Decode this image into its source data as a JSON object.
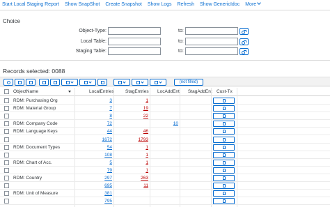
{
  "menu": {
    "items": [
      "Start Local Staging Report",
      "Show SnapShot",
      "Create Snapshot",
      "Show Logs",
      "Refresh",
      "Show GenericIdoc"
    ],
    "more_label": "More"
  },
  "choice": {
    "title": "Choice",
    "fields": [
      {
        "label": "Object-Type:",
        "value": "",
        "to_label": "to:",
        "to_value": ""
      },
      {
        "label": "Local Table:",
        "value": "",
        "to_label": "to:",
        "to_value": ""
      },
      {
        "label": "Staging Table:",
        "value": "",
        "to_label": "to:",
        "to_value": ""
      }
    ]
  },
  "records": {
    "label": "Records selected: 0088"
  },
  "toolbar": {
    "filter_badge": "(not filled)"
  },
  "grid": {
    "headers": {
      "object_name": "ObjectName",
      "local_entries": "LocalEntries",
      "stag_entries": "StagEntries",
      "loc_add_ent": "LocAddEnt",
      "stag_add_ent": "StagAddEnt",
      "cust_tx": "Cust-Tx"
    },
    "rows": [
      {
        "name": "RDM: Purchasing Org",
        "local": "3",
        "stag": "1",
        "locadd": "",
        "checkbox": true
      },
      {
        "name": "RDM: Material Group",
        "local": "7",
        "stag": "19",
        "locadd": "",
        "checkbox": true
      },
      {
        "name": "",
        "local": "8",
        "stag": "22",
        "locadd": "",
        "checkbox": true
      },
      {
        "name": "RDM: Company Code",
        "local": "72",
        "stag": "",
        "locadd": "10",
        "checkbox": true
      },
      {
        "name": "RDM: Language Keys",
        "local": "44",
        "stag": "46",
        "locadd": "",
        "checkbox": true
      },
      {
        "name": "",
        "local": "1672",
        "stag": "1793",
        "locadd": "",
        "checkbox": true
      },
      {
        "name": "RDM: Document Types",
        "local": "54",
        "stag": "1",
        "locadd": "",
        "checkbox": true
      },
      {
        "name": "",
        "local": "108",
        "stag": "1",
        "locadd": "",
        "checkbox": true
      },
      {
        "name": "RDM: Chart of Acc.",
        "local": "5",
        "stag": "1",
        "locadd": "",
        "checkbox": true
      },
      {
        "name": "",
        "local": "79",
        "stag": "1",
        "locadd": "",
        "checkbox": true
      },
      {
        "name": "RDM: Country",
        "local": "297",
        "stag": "263",
        "locadd": "",
        "checkbox": true
      },
      {
        "name": "",
        "local": "695",
        "stag": "11",
        "locadd": "",
        "checkbox": true
      },
      {
        "name": "RDM: Unit of Measure",
        "local": "381",
        "stag": "",
        "locadd": "",
        "checkbox": true
      },
      {
        "name": "",
        "local": "795",
        "stag": "",
        "locadd": "",
        "checkbox": true
      }
    ]
  }
}
